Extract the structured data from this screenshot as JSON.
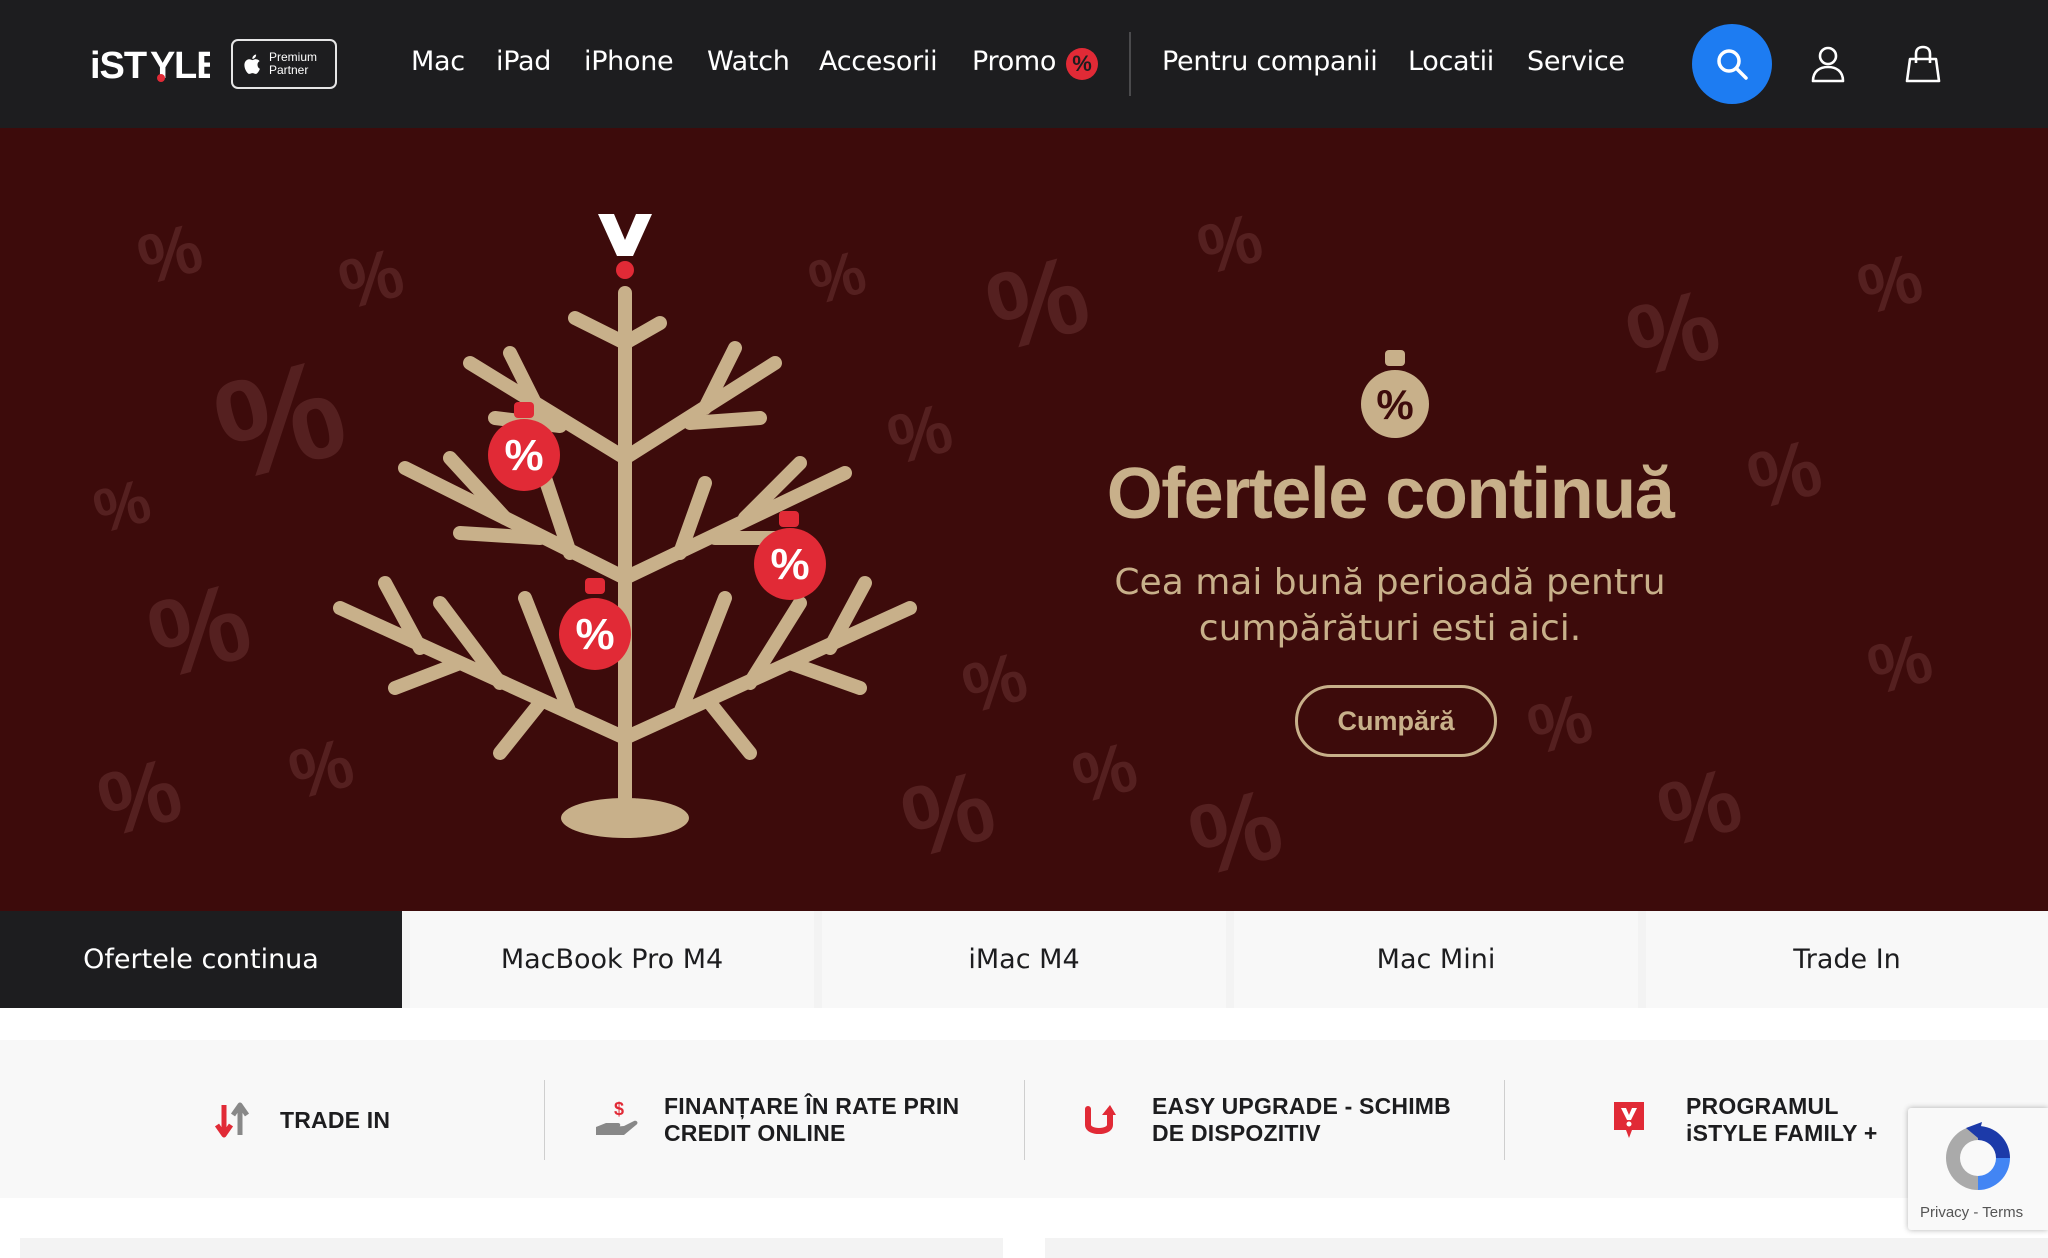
{
  "header": {
    "logo": "iSTYLE",
    "partner_badge": {
      "line1": "Premium",
      "line2": "Partner"
    },
    "nav": [
      {
        "label": "Mac"
      },
      {
        "label": "iPad"
      },
      {
        "label": "iPhone"
      },
      {
        "label": "Watch"
      },
      {
        "label": "Accesorii"
      },
      {
        "label": "Promo"
      }
    ],
    "promo_badge": "%",
    "nav_secondary": [
      {
        "label": "Pentru companii"
      },
      {
        "label": "Locatii"
      },
      {
        "label": "Service"
      }
    ],
    "icons": [
      "search-icon",
      "user-icon",
      "bag-icon"
    ],
    "accent_color": "#1d7cf2",
    "brand_red": "#e12a36"
  },
  "hero": {
    "title": "Ofertele continuă",
    "subtitle_line1": "Cea mai bună perioadă pentru",
    "subtitle_line2": "cumpărături esti aici.",
    "cta": "Cumpără",
    "background_color": "#3d0b0b",
    "gold_color": "#c8b08a",
    "ornament_symbol": "%"
  },
  "tabs": [
    {
      "label": "Ofertele continua",
      "active": true
    },
    {
      "label": "MacBook Pro M4",
      "active": false
    },
    {
      "label": "iMac M4",
      "active": false
    },
    {
      "label": "Mac Mini",
      "active": false
    },
    {
      "label": "Trade In",
      "active": false
    }
  ],
  "features": [
    {
      "line1": "TRADE IN",
      "line2": "",
      "icon": "trade-in-arrows-icon"
    },
    {
      "line1": "FINANȚARE ÎN RATE PRIN",
      "line2": "CREDIT ONLINE",
      "icon": "hand-money-icon"
    },
    {
      "line1": "EASY UPGRADE - SCHIMB",
      "line2": "DE DISPOZITIV",
      "icon": "upgrade-arrow-icon"
    },
    {
      "line1": "PROGRAMUL",
      "line2": "iSTYLE FAMILY +",
      "icon": "istyle-badge-icon"
    }
  ],
  "recaptcha": {
    "text": "Privacy - Terms"
  }
}
